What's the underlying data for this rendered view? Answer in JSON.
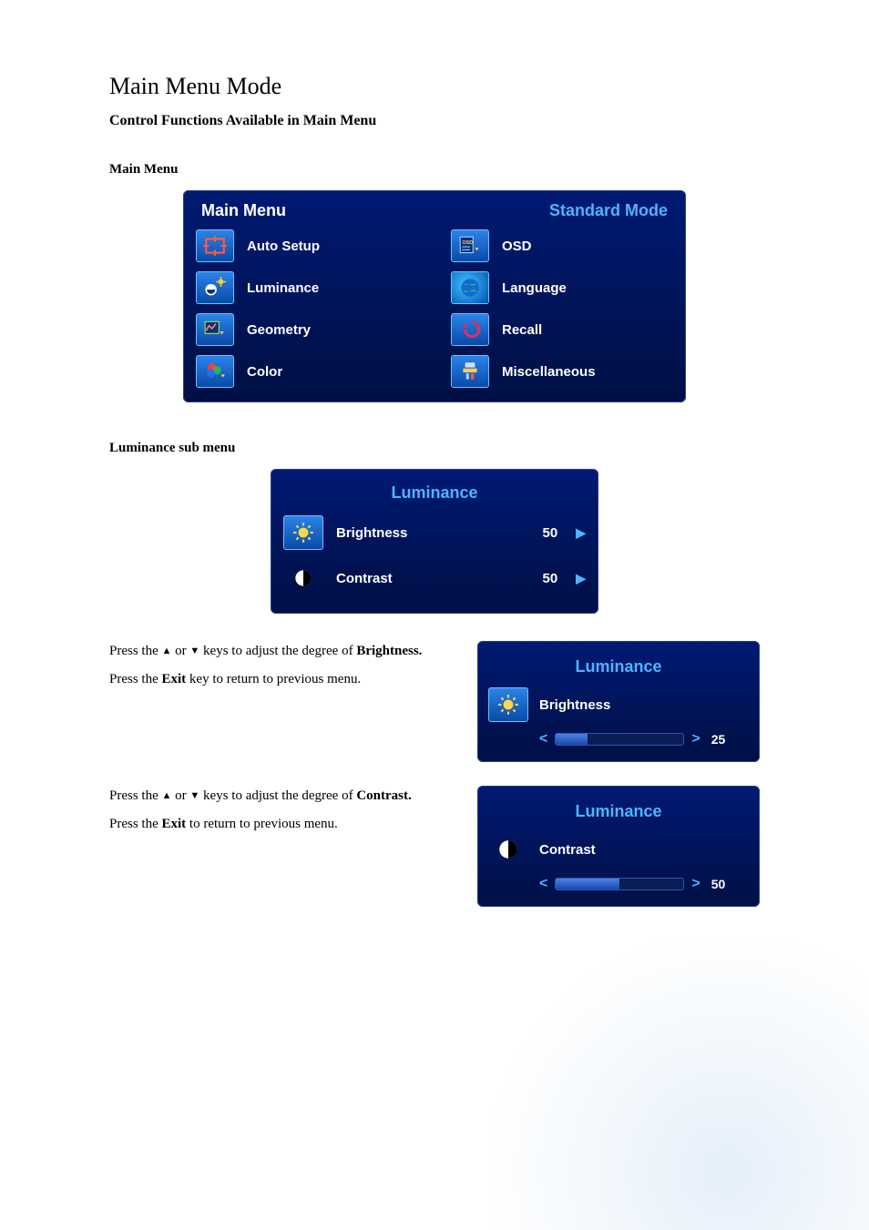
{
  "doc": {
    "title": "Main Menu Mode",
    "subtitle": "Control Functions Available in Main Menu",
    "section_main": "Main Menu",
    "section_lum": "Luminance sub menu"
  },
  "main_menu": {
    "header_left": "Main Menu",
    "header_right": "Standard Mode",
    "items_left": [
      {
        "label": "Auto Setup",
        "icon": "autosetup"
      },
      {
        "label": "Luminance",
        "icon": "luminance"
      },
      {
        "label": "Geometry",
        "icon": "geometry"
      },
      {
        "label": "Color",
        "icon": "color"
      }
    ],
    "items_right": [
      {
        "label": "OSD",
        "icon": "osd"
      },
      {
        "label": "Language",
        "icon": "globe"
      },
      {
        "label": "Recall",
        "icon": "recall"
      },
      {
        "label": "Miscellaneous",
        "icon": "misc"
      }
    ]
  },
  "lum_sub": {
    "title": "Luminance",
    "rows": [
      {
        "label": "Brightness",
        "value": "50",
        "icon": "brightness",
        "highlight": true
      },
      {
        "label": "Contrast",
        "value": "50",
        "icon": "contrast",
        "highlight": false
      }
    ]
  },
  "adjust": [
    {
      "title": "Luminance",
      "label": "Brightness",
      "icon": "brightness",
      "icon_highlight": true,
      "value": "25",
      "fill_pct": 25,
      "instr_lead": "Press the ",
      "instr_mid": " or ",
      "instr_tail": " keys to adjust the degree of ",
      "subject": "Brightness.",
      "instr2a": "Press the ",
      "instr2b": "Exit",
      "instr2c": " key to return to previous menu."
    },
    {
      "title": "Luminance",
      "label": "Contrast",
      "icon": "contrast",
      "icon_highlight": false,
      "value": "50",
      "fill_pct": 50,
      "instr_lead": "Press the ",
      "instr_mid": " or ",
      "instr_tail": " keys to adjust the degree of ",
      "subject": "Contrast.",
      "instr2a": "Press the ",
      "instr2b": "Exit",
      "instr2c": " to return to previous menu."
    }
  ]
}
